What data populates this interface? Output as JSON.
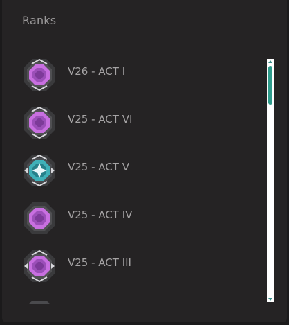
{
  "panel": {
    "title": "Ranks"
  },
  "ranks": [
    {
      "label": "V26 - ACT I",
      "icon": "platinum-rank-badge-icon",
      "gem_color": "#c86fe0"
    },
    {
      "label": "V25 - ACT VI",
      "icon": "platinum-rank-badge-icon",
      "gem_color": "#c86fe0"
    },
    {
      "label": "V25 - ACT V",
      "icon": "diamond-rank-badge-icon",
      "gem_color": "#3fb0b8"
    },
    {
      "label": "V25 - ACT IV",
      "icon": "platinum-rank-badge-icon",
      "gem_color": "#c86fe0"
    },
    {
      "label": "V25 - ACT III",
      "icon": "platinum-rank-badge-icon",
      "gem_color": "#c86fe0"
    }
  ],
  "colors": {
    "panel_bg": "#252324",
    "text": "#a5a3a4",
    "scroll_accent": "#2f9c8c"
  }
}
